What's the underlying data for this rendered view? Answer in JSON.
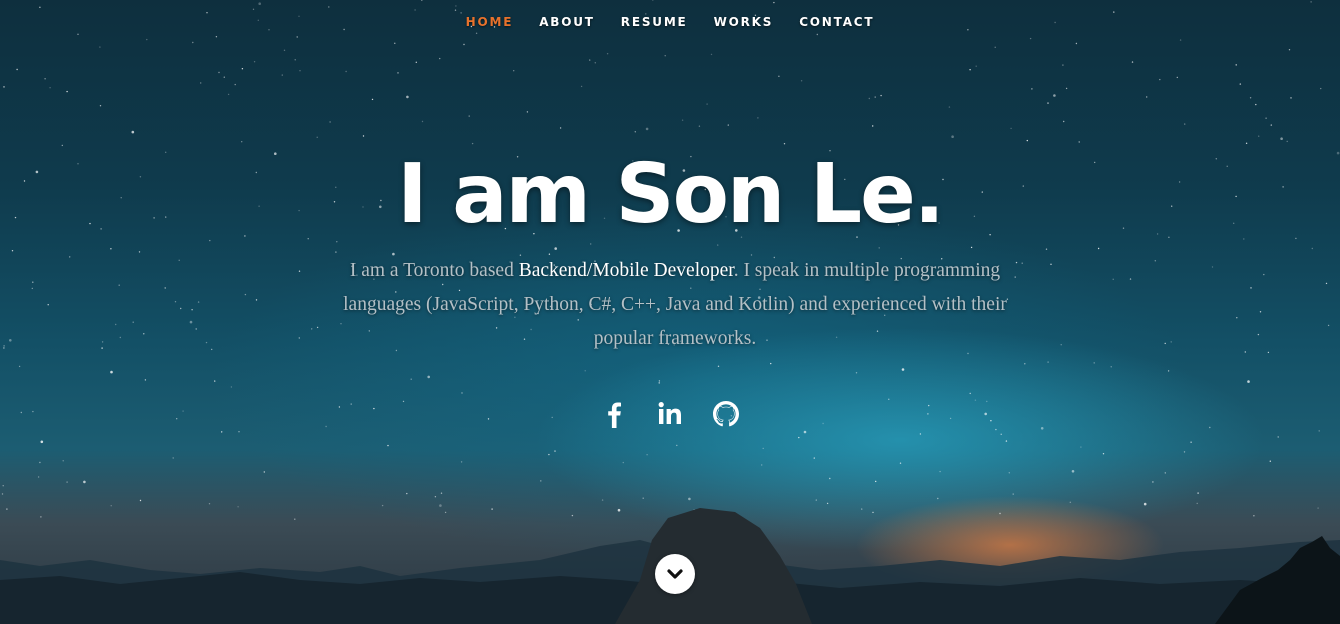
{
  "nav": {
    "items": [
      {
        "label": "HOME",
        "active": true
      },
      {
        "label": "ABOUT",
        "active": false
      },
      {
        "label": "RESUME",
        "active": false
      },
      {
        "label": "WORKS",
        "active": false
      },
      {
        "label": "CONTACT",
        "active": false
      }
    ]
  },
  "hero": {
    "headline": "I am Son Le.",
    "intro_before": "I am a Toronto based ",
    "intro_highlight": "Backend/Mobile Developer",
    "intro_after": ". I speak in multiple programming languages (JavaScript, Python, C#, C++, Java and Kotlin) and experienced with their popular frameworks."
  },
  "social": {
    "icons": [
      "facebook-icon",
      "linkedin-icon",
      "github-icon"
    ]
  },
  "scroll": {
    "icon": "chevron-down-icon"
  },
  "colors": {
    "accent": "#e8722c",
    "text": "#ffffff",
    "muted_text": "#b4c0c6"
  }
}
